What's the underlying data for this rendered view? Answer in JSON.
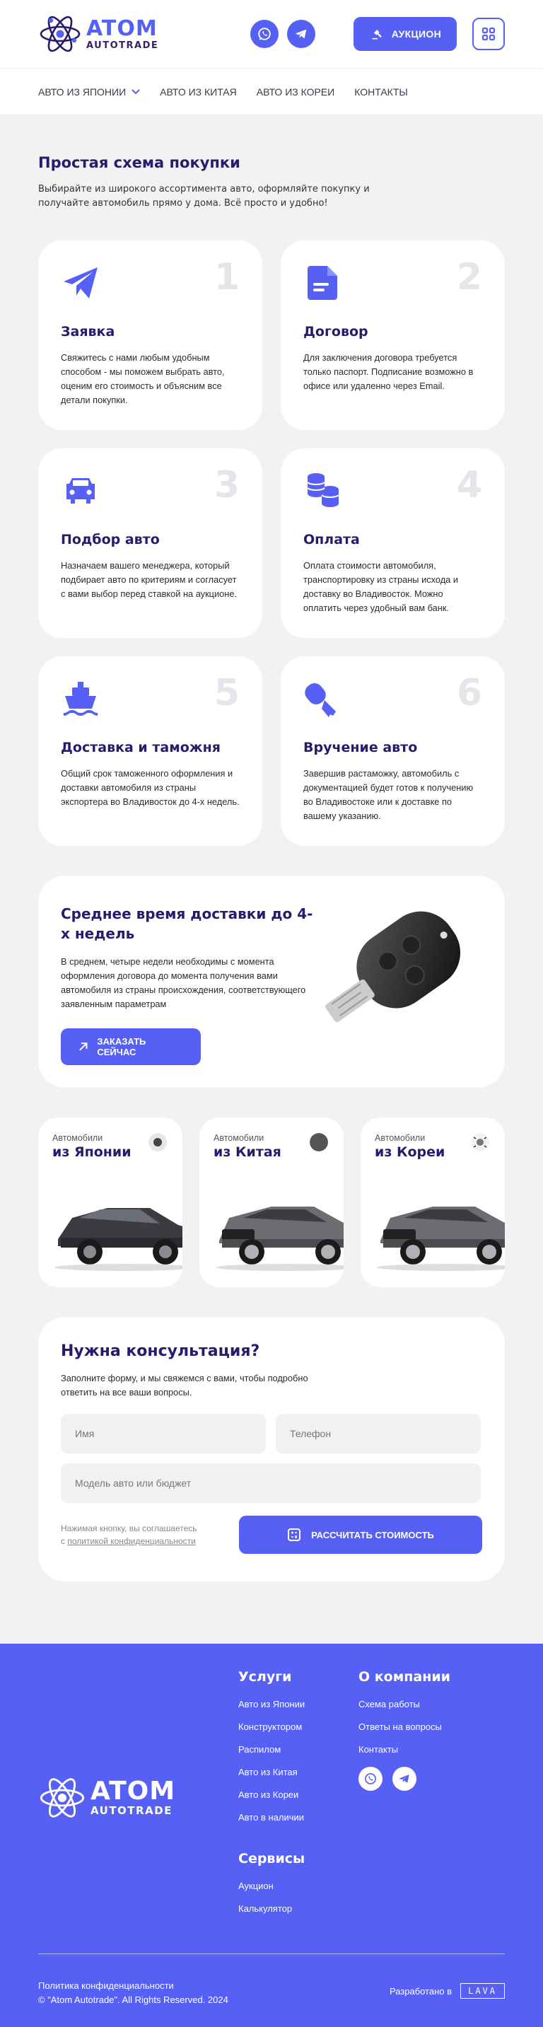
{
  "header": {
    "logo_word": "ATOM",
    "logo_sub": "AUTOTRADE",
    "auction_label": "АУКЦИОН"
  },
  "nav": {
    "items": [
      "АВТО ИЗ ЯПОНИИ",
      "АВТО ИЗ КИТАЯ",
      "АВТО ИЗ КОРЕИ",
      "КОНТАКТЫ"
    ]
  },
  "scheme": {
    "title": "Простая схема покупки",
    "lead": "Выбирайте из широкого ассортимента авто, оформляйте покупку и получайте автомобиль прямо у дома. Всё просто и удобно!",
    "steps": [
      {
        "num": "1",
        "icon": "paper-plane-icon",
        "title": "Заявка",
        "text": "Свяжитесь с нами любым удобным способом - мы поможем выбрать авто, оценим его стоимость и объясним все детали покупки."
      },
      {
        "num": "2",
        "icon": "document-icon",
        "title": "Договор",
        "text": "Для заключения договора требуется только паспорт. Подписание возможно в офисе или удаленно через Email."
      },
      {
        "num": "3",
        "icon": "car-icon",
        "title": "Подбор авто",
        "text": "Назначаем вашего менеджера, который подбирает авто по критериям и согласует с вами выбор перед ставкой на аукционе."
      },
      {
        "num": "4",
        "icon": "coins-icon",
        "title": "Оплата",
        "text": "Оплата стоимости автомобиля, транспортировку из страны исхода и доставку во Владивосток. Можно оплатить через удобный вам банк."
      },
      {
        "num": "5",
        "icon": "ship-icon",
        "title": "Доставка и таможня",
        "text": "Общий срок таможенного оформления и доставки автомобиля из страны экспортера во Владивосток до 4-х недель."
      },
      {
        "num": "6",
        "icon": "key-icon",
        "title": "Вручение авто",
        "text": "Завершив растаможку, автомобиль с документацией будет готов к получению во Владивостоке или к доставке по вашему указанию."
      }
    ]
  },
  "delivery": {
    "title": "Среднее время доставки до 4-х недель",
    "text": "В среднем, четыре недели необходимы с момента оформления договора до момента получения вами автомобиля из страны происхождения, соответствующего заявленным параметрам",
    "button": "ЗАКАЗАТЬ СЕЙЧАС"
  },
  "countries": [
    {
      "small": "Автомобили",
      "big": "из Японии",
      "flag": "japan-flag-icon"
    },
    {
      "small": "Автомобили",
      "big": "из Китая",
      "flag": "china-flag-icon"
    },
    {
      "small": "Автомобили",
      "big": "из Кореи",
      "flag": "korea-flag-icon"
    }
  ],
  "consult": {
    "title": "Нужна консультация?",
    "lead": "Заполните форму, и мы свяжемся с вами, чтобы подробно ответить на все ваши вопросы.",
    "name_placeholder": "Имя",
    "phone_placeholder": "Телефон",
    "model_placeholder": "Модель авто или бюджет",
    "agree_text": "Нажимая кнопку, вы соглашаетесь",
    "agree_link_prefix": "с ",
    "agree_link": "политикой конфиденциальности",
    "button": "РАССЧИТАТЬ СТОИМОСТЬ"
  },
  "footer": {
    "logo_word": "ATOM",
    "logo_sub": "AUTOTRADE",
    "services_title": "Услуги",
    "services": [
      "Авто из Японии",
      "Конструктором",
      "Распилом",
      "Авто из Китая",
      "Авто из Кореи",
      "Авто в наличии"
    ],
    "tools_title": "Сервисы",
    "tools": [
      "Аукцион",
      "Калькулятор"
    ],
    "company_title": "О компании",
    "company": [
      "Схема работы",
      "Ответы на вопросы",
      "Контакты"
    ],
    "privacy": "Политика конфиденциальности",
    "copyright": "©  \"Atom Autotrade\". All Rights Reserved. 2024",
    "dev_label": "Разработано в",
    "dev_brand": "LAVA"
  }
}
